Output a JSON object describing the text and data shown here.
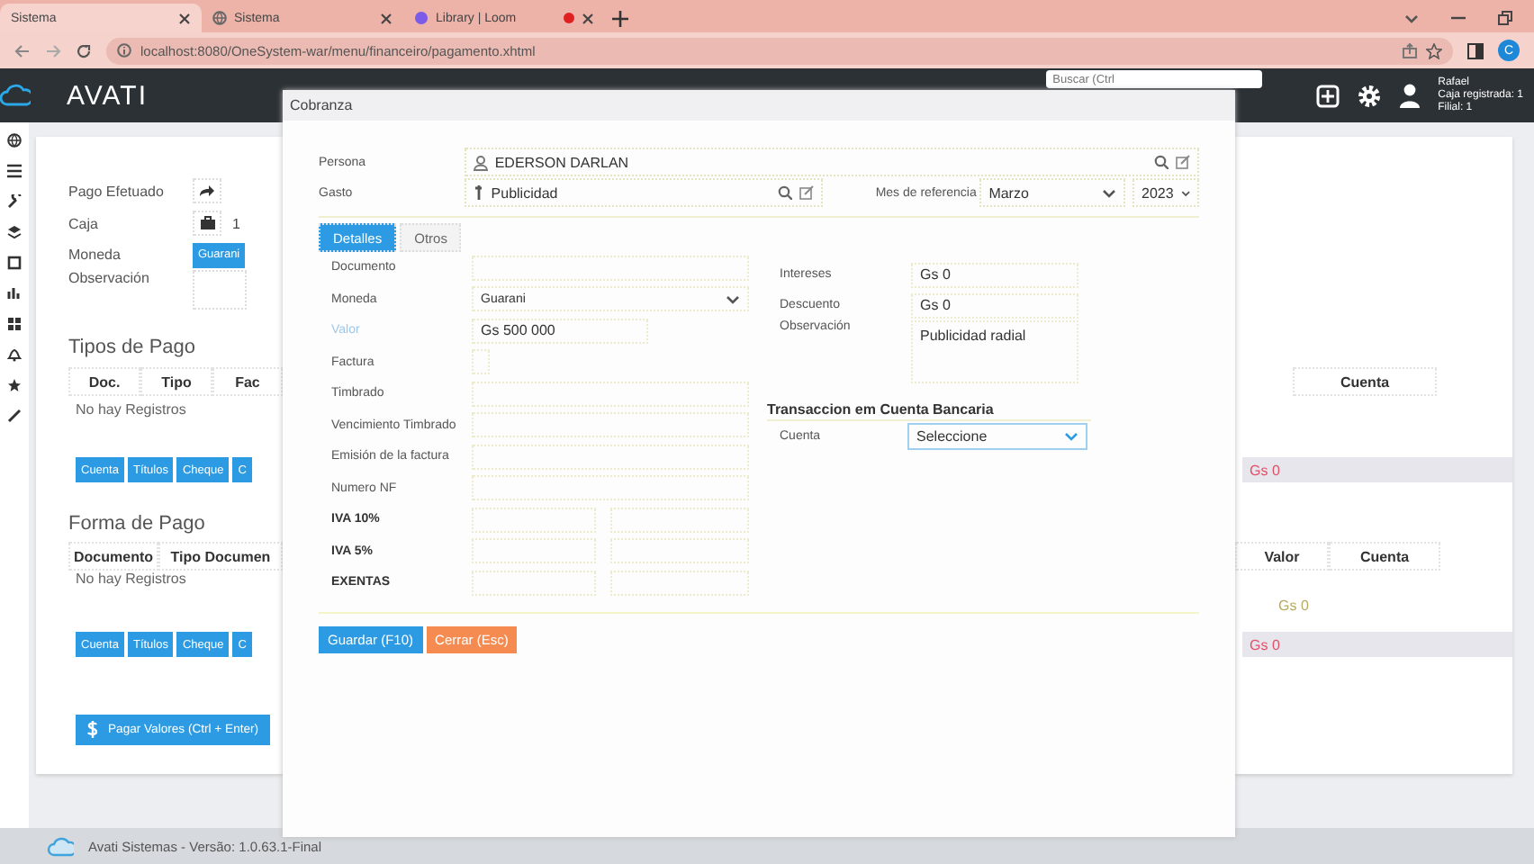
{
  "browser": {
    "tabs": [
      {
        "title": "Sistema",
        "selected": true,
        "recording": false
      },
      {
        "title": "Sistema",
        "selected": false,
        "recording": false
      },
      {
        "title": "Library | Loom",
        "selected": false,
        "recording": true
      }
    ],
    "address": "localhost:8080/OneSystem-war/menu/financeiro/pagamento.xhtml",
    "profile_initial": "C"
  },
  "header": {
    "brand": "AVATI",
    "search_placeholder": "Buscar (Ctrl",
    "user": {
      "name": "Rafael",
      "cash_register": "Caja registrada: 1",
      "branch": "Filial: 1"
    }
  },
  "payment": {
    "fields": [
      {
        "label": "Pago Efetuado",
        "kind": "share"
      },
      {
        "label": "Caja",
        "kind": "register",
        "value": "1"
      },
      {
        "label": "Moneda",
        "kind": "button",
        "value": "Guarani"
      },
      {
        "label": "Observación",
        "kind": "textarea"
      }
    ],
    "payment_types": {
      "title": "Tipos de Pago",
      "columns": [
        "Doc.",
        "Tipo",
        "Fac"
      ],
      "right_columns": [
        "Cuenta"
      ],
      "empty": "No hay Registros",
      "buttons": [
        "Cuenta",
        "Títulos",
        "Cheque",
        "C"
      ],
      "total": "Gs 0"
    },
    "payment_forms": {
      "title": "Forma de Pago",
      "columns": [
        "Documento",
        "Tipo Documen"
      ],
      "right_columns": [
        "Valor",
        "Cuenta"
      ],
      "empty": "No hay Registros",
      "row_value": "Gs 0",
      "buttons": [
        "Cuenta",
        "Títulos",
        "Cheque",
        "C"
      ],
      "total": "Gs 0"
    },
    "pay_button": "Pagar Valores (Ctrl + Enter)"
  },
  "modal": {
    "title": "Cobranza",
    "persona": {
      "label": "Persona",
      "value": "EDERSON DARLAN"
    },
    "gasto": {
      "label": "Gasto",
      "value": "Publicidad"
    },
    "month": {
      "label": "Mes de referencia",
      "value": "Marzo",
      "year": "2023"
    },
    "tabs": [
      {
        "label": "Detalles",
        "selected": true
      },
      {
        "label": "Otros",
        "selected": false
      }
    ],
    "details": [
      {
        "label": "Documento",
        "kind": "text",
        "focused": false
      },
      {
        "label": "Moneda",
        "kind": "select",
        "value": "Guarani",
        "focused": false
      },
      {
        "label": "Valor",
        "kind": "short",
        "value": "Gs 500 000",
        "focused": true
      },
      {
        "label": "Factura",
        "kind": "small",
        "focused": false
      },
      {
        "label": "Timbrado",
        "kind": "text",
        "focused": false
      },
      {
        "label": "Vencimiento Timbrado",
        "kind": "text",
        "focused": false
      },
      {
        "label": "Emisión de la factura",
        "kind": "text",
        "focused": false
      },
      {
        "label": "Numero NF",
        "kind": "text",
        "focused": false
      },
      {
        "label": "IVA 10%",
        "kind": "tax",
        "focused": false
      },
      {
        "label": "IVA 5%",
        "kind": "tax",
        "focused": false
      },
      {
        "label": "EXENTAS",
        "kind": "tax",
        "focused": false
      }
    ],
    "extras": [
      {
        "label": "Intereses",
        "kind": "text",
        "value": "Gs 0"
      },
      {
        "label": "Descuento",
        "kind": "text",
        "value": "Gs 0"
      },
      {
        "label": "Observación",
        "kind": "textarea",
        "value": "Publicidad radial"
      }
    ],
    "bank": {
      "title": "Transaccion em Cuenta Bancaria",
      "label": "Cuenta",
      "value": "Seleccione"
    },
    "buttons": [
      {
        "label": "Guardar (F10)",
        "kind": "primary"
      },
      {
        "label": "Cerrar (Esc)",
        "kind": "warning"
      }
    ]
  },
  "footer": "Avati Sistemas - Versão: 1.0.63.1-Final"
}
